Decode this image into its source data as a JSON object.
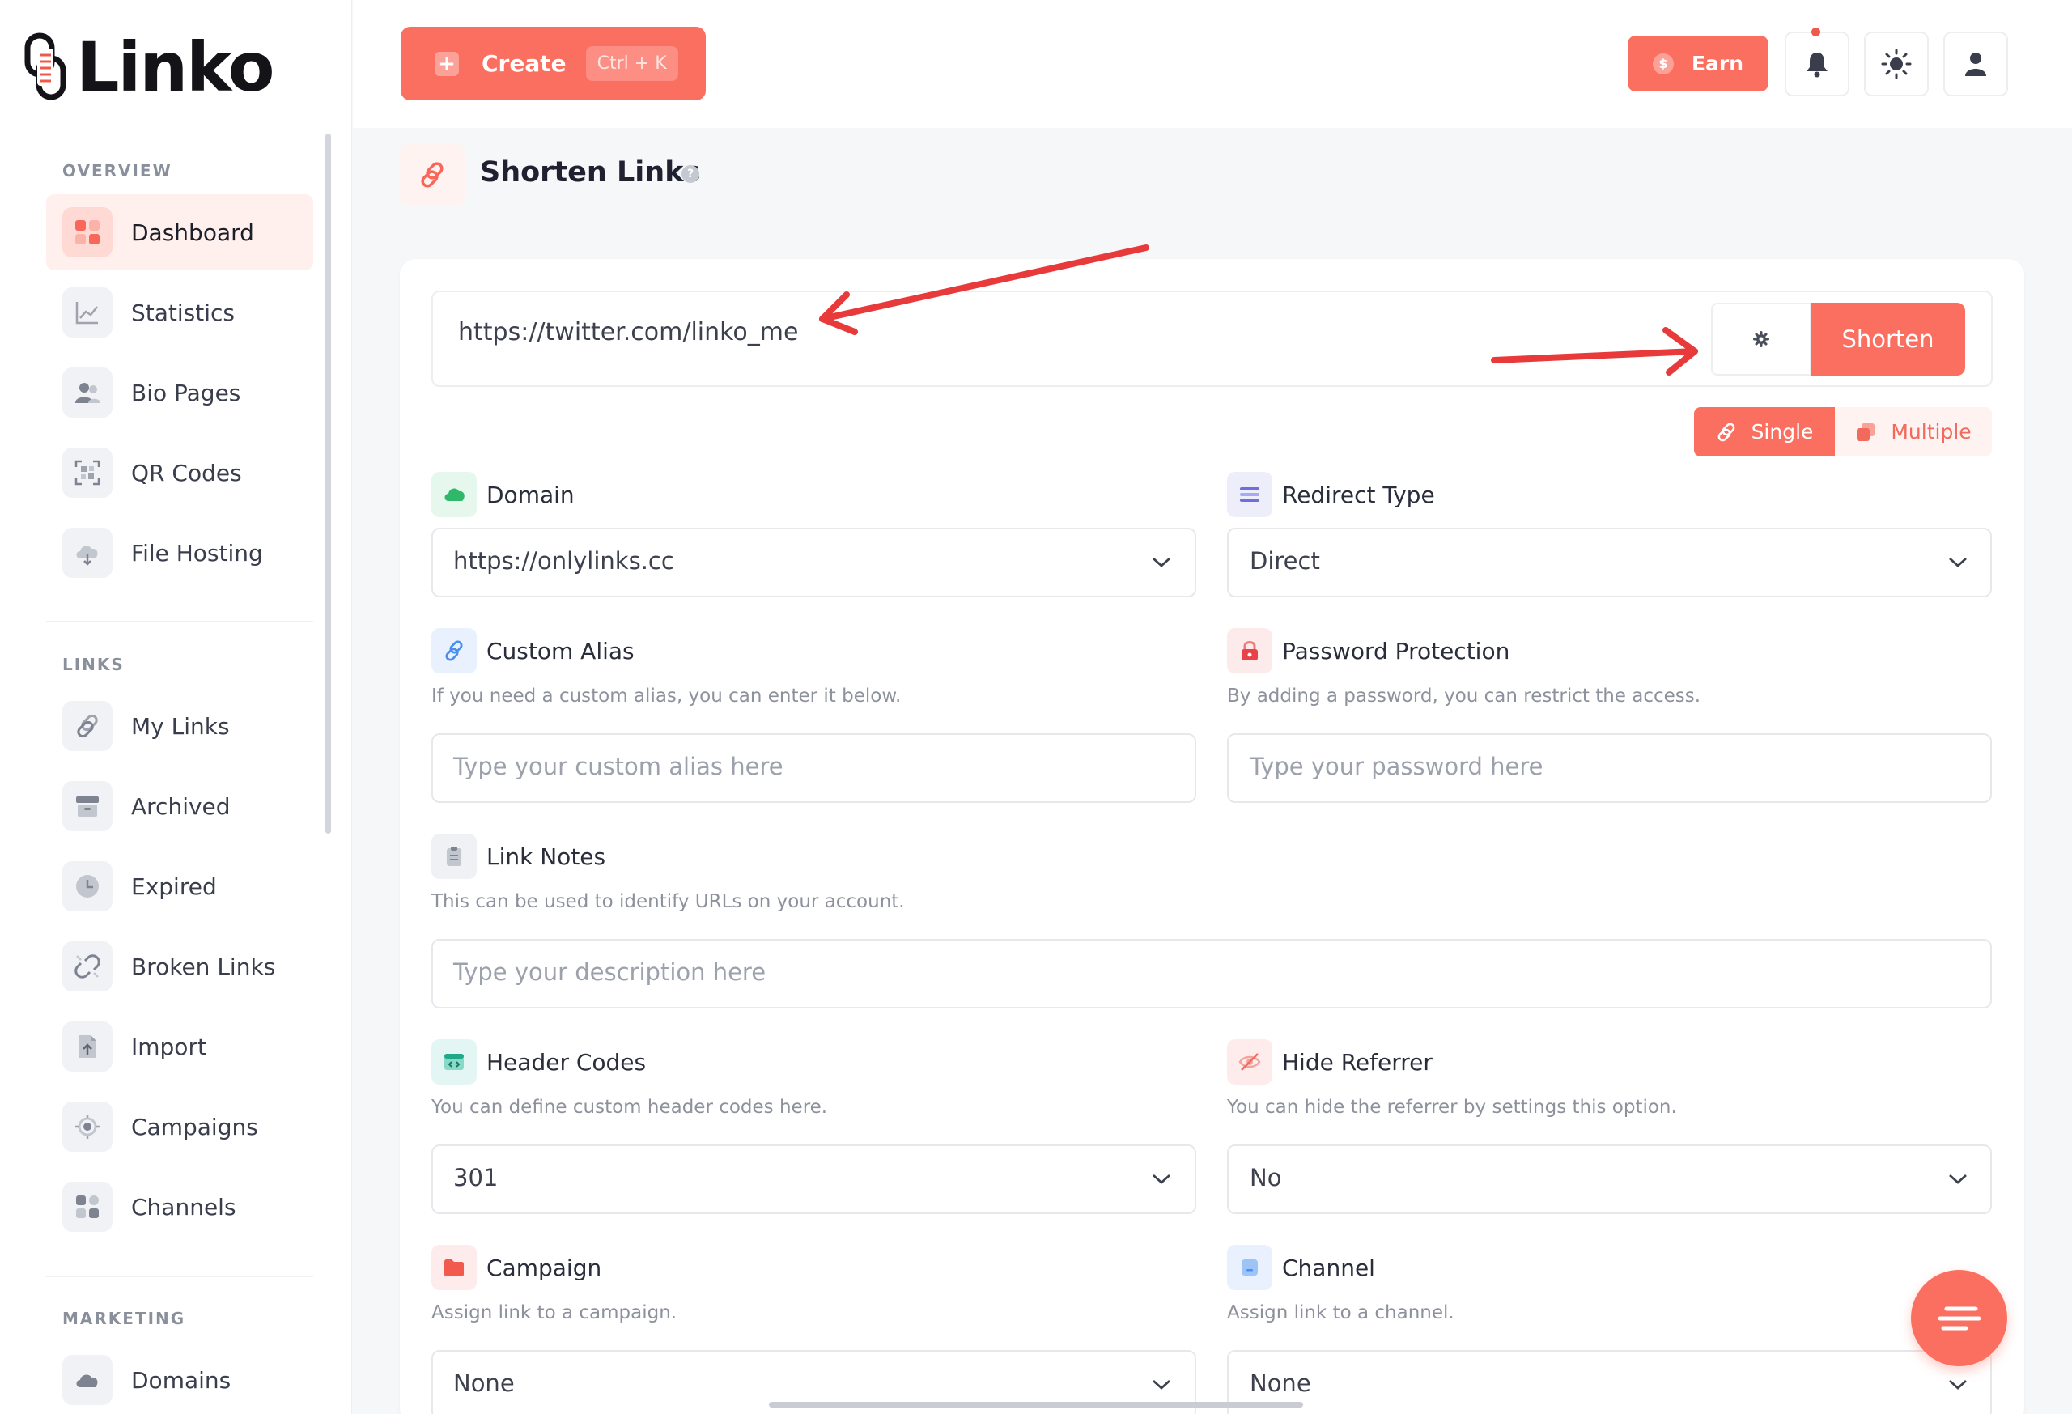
{
  "app": {
    "name": "Linko"
  },
  "sidebar": {
    "sections": [
      {
        "label": "OVERVIEW"
      },
      {
        "label": "LINKS"
      },
      {
        "label": "MARKETING"
      }
    ],
    "items": [
      {
        "label": "Dashboard",
        "icon": "grid-icon",
        "active": true
      },
      {
        "label": "Statistics",
        "icon": "chart-icon"
      },
      {
        "label": "Bio Pages",
        "icon": "users-icon"
      },
      {
        "label": "QR Codes",
        "icon": "qr-icon"
      },
      {
        "label": "File Hosting",
        "icon": "cloud-icon"
      },
      {
        "label": "My Links",
        "icon": "link-icon"
      },
      {
        "label": "Archived",
        "icon": "archive-icon"
      },
      {
        "label": "Expired",
        "icon": "clock-icon"
      },
      {
        "label": "Broken Links",
        "icon": "broken-link-icon"
      },
      {
        "label": "Import",
        "icon": "file-import-icon"
      },
      {
        "label": "Campaigns",
        "icon": "target-icon"
      },
      {
        "label": "Channels",
        "icon": "apps-icon"
      },
      {
        "label": "Domains",
        "icon": "cloud-icon"
      }
    ]
  },
  "topbar": {
    "create_label": "Create",
    "create_shortcut": "Ctrl + K",
    "earn_label": "Earn",
    "icons": [
      "bell-icon",
      "sun-icon",
      "user-icon"
    ]
  },
  "page": {
    "title": "Shorten Links",
    "help": "?"
  },
  "shortener": {
    "url_value": "https://twitter.com/linko_me",
    "shorten_label": "Shorten",
    "mode_single": "Single",
    "mode_multiple": "Multiple"
  },
  "fields": {
    "domain": {
      "label": "Domain",
      "value": "https://onlylinks.cc"
    },
    "redirect": {
      "label": "Redirect Type",
      "value": "Direct"
    },
    "alias": {
      "label": "Custom Alias",
      "help": "If you need a custom alias, you can enter it below.",
      "placeholder": "Type your custom alias here"
    },
    "password": {
      "label": "Password Protection",
      "help": "By adding a password, you can restrict the access.",
      "placeholder": "Type your password here"
    },
    "notes": {
      "label": "Link Notes",
      "help": "This can be used to identify URLs on your account.",
      "placeholder": "Type your description here"
    },
    "header_codes": {
      "label": "Header Codes",
      "help": "You can define custom header codes here.",
      "value": "301"
    },
    "hide_referrer": {
      "label": "Hide Referrer",
      "help": "You can hide the referrer by settings this option.",
      "value": "No"
    },
    "campaign": {
      "label": "Campaign",
      "help": "Assign link to a campaign.",
      "value": "None"
    },
    "channel": {
      "label": "Channel",
      "help": "Assign link to a channel.",
      "value": "None"
    }
  },
  "colors": {
    "accent": "#fb6f61",
    "accent_soft": "#fff3f1",
    "annotation_arrow": "#e83a3a"
  }
}
